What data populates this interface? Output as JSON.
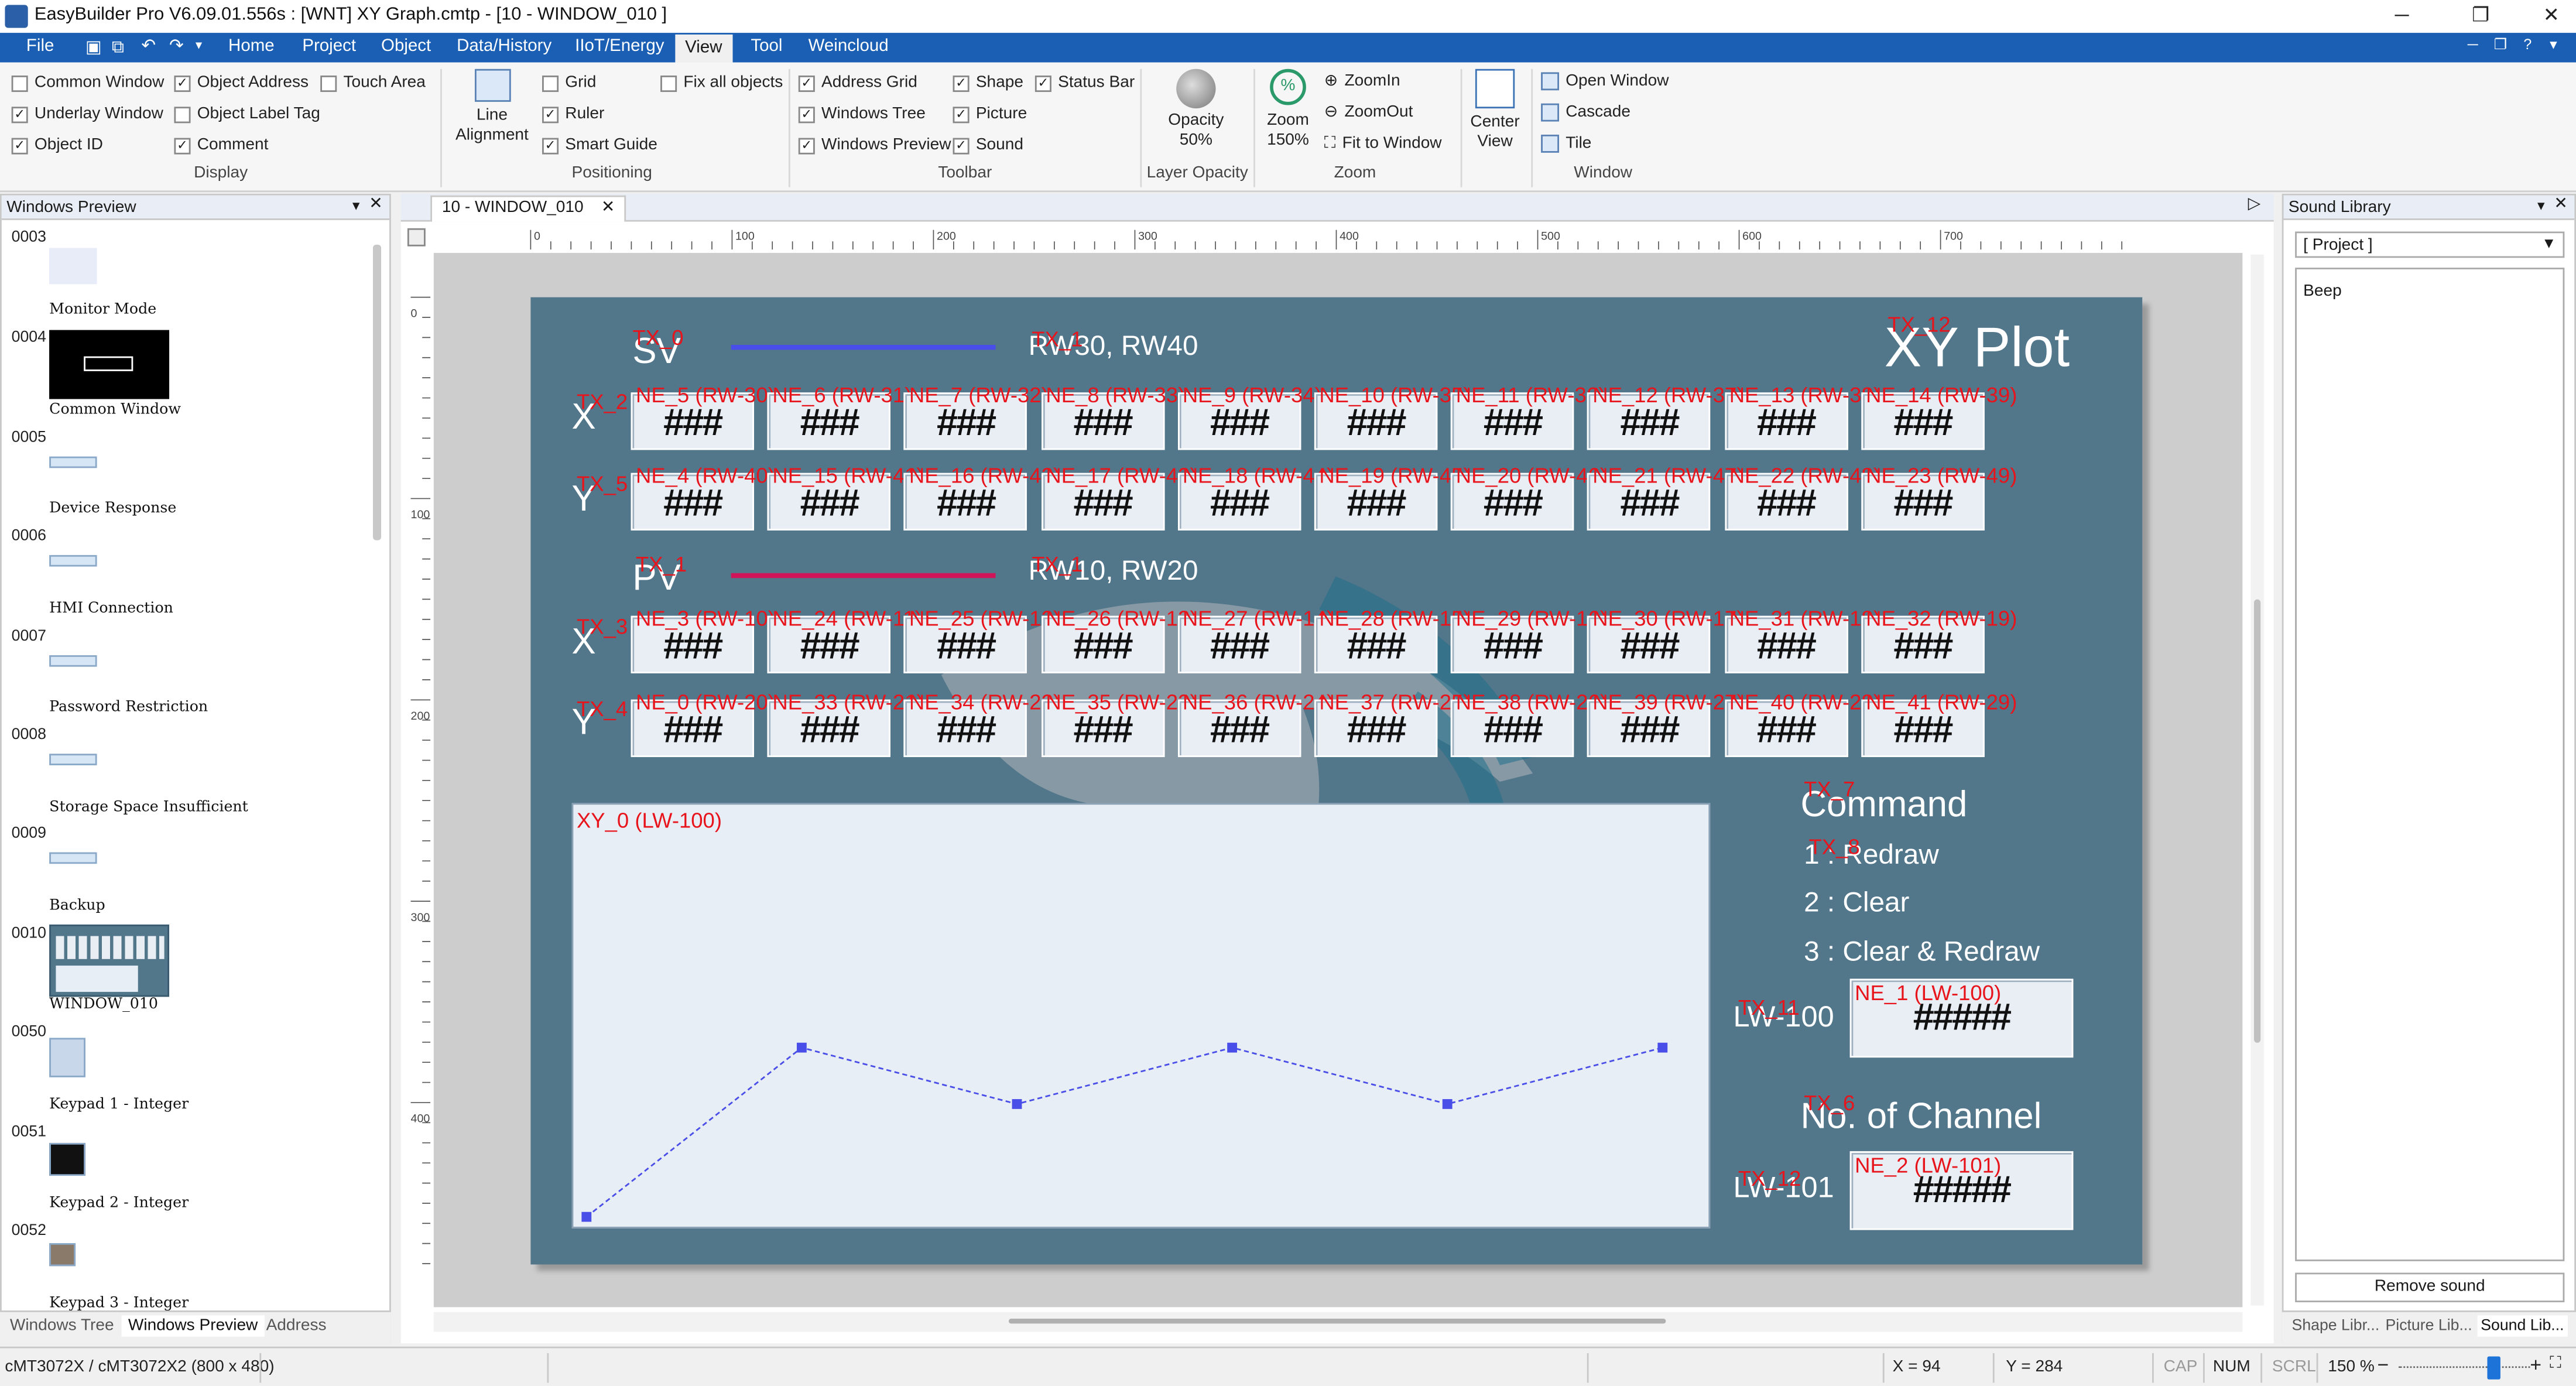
{
  "window": {
    "title": "EasyBuilder Pro V6.09.01.556s : [WNT] XY Graph.cmtp - [10 - WINDOW_010 ]"
  },
  "menu": {
    "items": [
      "File",
      "Home",
      "Project",
      "Object",
      "Data/History",
      "IIoT/Energy",
      "View",
      "Tool",
      "Weincloud"
    ],
    "active": "View"
  },
  "ribbon": {
    "display": {
      "label": "Display",
      "checks": [
        {
          "label": "Common Window",
          "checked": false
        },
        {
          "label": "Object Address",
          "checked": true
        },
        {
          "label": "Touch Area",
          "checked": false
        },
        {
          "label": "Underlay Window",
          "checked": true
        },
        {
          "label": "Object Label Tag",
          "checked": false
        },
        {
          "label": "Object ID",
          "checked": true
        },
        {
          "label": "Comment",
          "checked": true
        }
      ]
    },
    "positioning": {
      "label": "Positioning",
      "line_alignment": "Line\nAlignment",
      "checks": [
        {
          "label": "Grid",
          "checked": false
        },
        {
          "label": "Ruler",
          "checked": true
        },
        {
          "label": "Smart Guide",
          "checked": true
        },
        {
          "label": "Fix all objects",
          "checked": false
        }
      ]
    },
    "toolbar": {
      "label": "Toolbar",
      "checks": [
        {
          "label": "Address Grid",
          "checked": true
        },
        {
          "label": "Shape",
          "checked": true
        },
        {
          "label": "Status Bar",
          "checked": true
        },
        {
          "label": "Windows Tree",
          "checked": true
        },
        {
          "label": "Picture",
          "checked": true
        },
        {
          "label": "Windows Preview",
          "checked": true
        },
        {
          "label": "Sound",
          "checked": true
        }
      ]
    },
    "layer_opacity": {
      "label": "Layer Opacity",
      "button": "Opacity",
      "value": "50%"
    },
    "zoom": {
      "label": "Zoom",
      "button": "Zoom",
      "value": "150%",
      "items": [
        "ZoomIn",
        "ZoomOut",
        "Fit to Window"
      ]
    },
    "center_view": "Center\nView",
    "window_group": {
      "label": "Window",
      "items": [
        "Open Window",
        "Cascade",
        "Tile"
      ]
    }
  },
  "left_panel": {
    "title": "Windows Preview",
    "items": [
      {
        "id": "0003",
        "name": "Monitor Mode"
      },
      {
        "id": "0004",
        "name": "Common Window"
      },
      {
        "id": "0005",
        "name": "Device Response"
      },
      {
        "id": "0006",
        "name": "HMI Connection"
      },
      {
        "id": "0007",
        "name": "Password Restriction"
      },
      {
        "id": "0008",
        "name": "Storage Space Insufficient"
      },
      {
        "id": "0009",
        "name": "Backup"
      },
      {
        "id": "0010",
        "name": "WINDOW_010"
      },
      {
        "id": "0050",
        "name": "Keypad 1 - Integer"
      },
      {
        "id": "0051",
        "name": "Keypad 2 - Integer"
      },
      {
        "id": "0052",
        "name": "Keypad 3 - Integer"
      }
    ],
    "tabs": [
      "Windows Tree",
      "Windows Preview",
      "Address"
    ],
    "active_tab": "Windows Preview"
  },
  "doc_tab": {
    "label": "10 - WINDOW_010"
  },
  "ruler": {
    "labels": [
      "0",
      "100",
      "200",
      "300",
      "400",
      "500",
      "600",
      "700"
    ]
  },
  "vruler": {
    "labels": [
      "0",
      "100",
      "200",
      "300",
      "400"
    ]
  },
  "hmi": {
    "title": "XY Plot",
    "sv_label": "SV",
    "sv_addr": "RW30, RW40",
    "pv_label": "PV",
    "pv_addr": "RW10, RW20",
    "hash": "###",
    "hash5": "#####",
    "tx": {
      "sv": "TX_0",
      "sv_addr": "TX_1",
      "title": "TX_12",
      "x1": "TX_2",
      "y1": "TX_5",
      "pv": "TX_1",
      "pv_addr": "TX_1",
      "x2": "TX_3",
      "y2": "TX_4",
      "cmd": "TX_7",
      "redraw": "TX_8",
      "lw100": "TX_11",
      "ch": "TX_6",
      "lw101": "TX_12"
    },
    "row_labels": [
      "X",
      "Y",
      "X",
      "Y"
    ],
    "rows": [
      [
        "NE_5 (RW-30)",
        "NE_6 (RW-31)",
        "NE_7 (RW-32)",
        "NE_8 (RW-33)",
        "NE_9 (RW-34)",
        "NE_10 (RW-35)",
        "NE_11 (RW-36)",
        "NE_12 (RW-37)",
        "NE_13 (RW-38)",
        "NE_14 (RW-39)"
      ],
      [
        "NE_4 (RW-40)",
        "NE_15 (RW-41)",
        "NE_16 (RW-42)",
        "NE_17 (RW-43)",
        "NE_18 (RW-44)",
        "NE_19 (RW-45)",
        "NE_20 (RW-46)",
        "NE_21 (RW-47)",
        "NE_22 (RW-48)",
        "NE_23 (RW-49)"
      ],
      [
        "NE_3 (RW-10)",
        "NE_24 (RW-11)",
        "NE_25 (RW-12)",
        "NE_26 (RW-13)",
        "NE_27 (RW-14)",
        "NE_28 (RW-15)",
        "NE_29 (RW-16)",
        "NE_30 (RW-17)",
        "NE_31 (RW-18)",
        "NE_32 (RW-19)"
      ],
      [
        "NE_0 (RW-20)",
        "NE_33 (RW-21)",
        "NE_34 (RW-22)",
        "NE_35 (RW-23)",
        "NE_36 (RW-24)",
        "NE_37 (RW-25)",
        "NE_38 (RW-26)",
        "NE_39 (RW-27)",
        "NE_40 (RW-28)",
        "NE_41 (RW-29)"
      ]
    ],
    "xy_label": "XY_0 (LW-100)",
    "xy_points": [
      [
        0,
        0
      ],
      [
        1,
        0.45
      ],
      [
        2,
        0.3
      ],
      [
        3,
        0.45
      ],
      [
        4,
        0.3
      ],
      [
        5,
        0.45
      ]
    ],
    "command_title": "Command",
    "cmd_lines": [
      "1 : Redraw",
      "2 : Clear",
      "3 : Clear & Redraw"
    ],
    "lw100_label": "LW-100",
    "ne1": "NE_1 (LW-100)",
    "channel_title": "No. of Channel",
    "lw101_label": "LW-101",
    "ne2": "NE_2 (LW-101)",
    "colors": {
      "bg": "#52768a",
      "sv_line": "#4a4ee8",
      "pv_line": "#d0145a",
      "accent": "#e8141c"
    }
  },
  "right_panel": {
    "title": "Sound Library",
    "dropdown": "[ Project ]",
    "items": [
      "Beep"
    ],
    "remove_button": "Remove sound",
    "tabs": [
      "Shape Libr...",
      "Picture Lib...",
      "Sound Lib..."
    ],
    "active_tab": "Sound Lib..."
  },
  "status": {
    "device": "cMT3072X / cMT3072X2 (800 x 480)",
    "x": "X = 94",
    "y": "Y = 284",
    "cap": "CAP",
    "num": "NUM",
    "scrl": "SCRL",
    "zoom": "150 %"
  }
}
